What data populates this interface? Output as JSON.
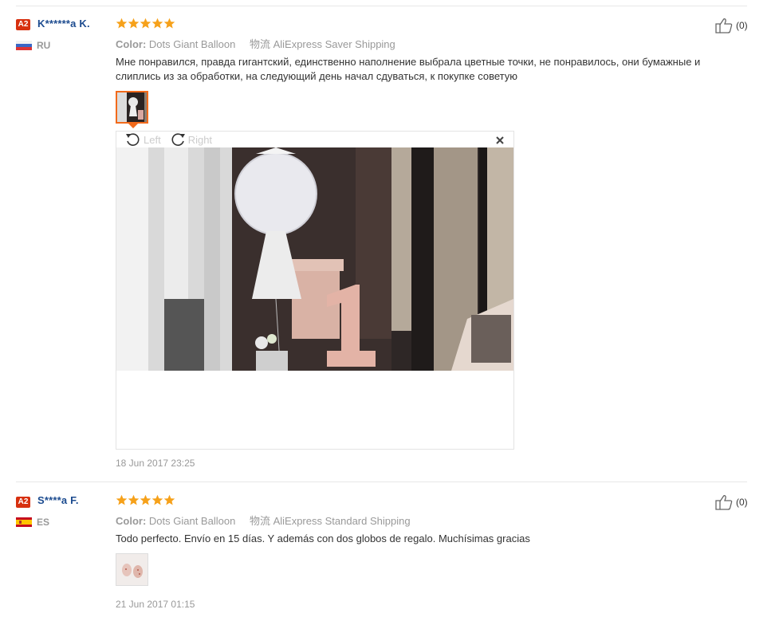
{
  "reviews": [
    {
      "badge": "A2",
      "name": "K******a K.",
      "country": "RU",
      "rating": 5,
      "color_label": "Color:",
      "color_value": "Dots Giant Balloon",
      "shipping_label": "物流",
      "shipping_value": "AliExpress Saver Shipping",
      "text": "Мне понравился, правда гигантский, единственно наполнение выбрала цветные точки, не понравилось, они бумажные и слиплись из за обработки, на следующий день начал сдуваться, к покупке советую",
      "date": "18 Jun 2017 23:25",
      "helpful_count": "(0)",
      "viewer": {
        "left_label": "Left",
        "right_label": "Right"
      }
    },
    {
      "badge": "A2",
      "name": "S****a F.",
      "country": "ES",
      "rating": 5,
      "color_label": "Color:",
      "color_value": "Dots Giant Balloon",
      "shipping_label": "物流",
      "shipping_value": "AliExpress Standard Shipping",
      "text": "Todo perfecto. Envío en 15 días. Y además con dos globos de regalo. Muchísimas gracias",
      "date": "21 Jun 2017 01:15",
      "helpful_count": "(0)"
    }
  ],
  "colors": {
    "star": "#f6a11a",
    "name": "#1c4b8f",
    "badge": "#d7300f",
    "accent": "#f26a1b"
  }
}
